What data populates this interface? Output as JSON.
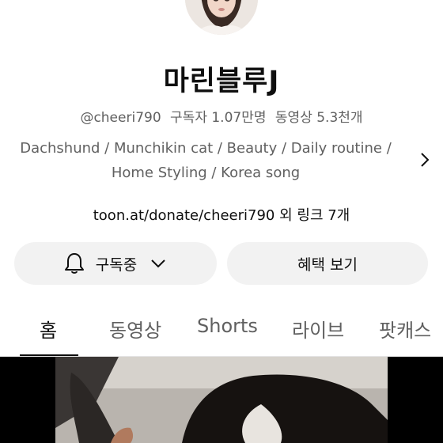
{
  "channel": {
    "name": "마린블루J",
    "handle": "@cheeri790",
    "subscribers": "구독자 1.07만명",
    "videos": "동영상 5.3천개",
    "description_line1": "Dachshund / Munchikin cat / Beauty / Daily routine /",
    "description_line2": "Home Styling / Korea song",
    "link_text": "toon.at/donate/cheeri790 외 링크 7개"
  },
  "actions": {
    "subscribe_label": "구독중",
    "benefits_label": "혜택 보기"
  },
  "tabs": [
    {
      "label": "홈",
      "active": true
    },
    {
      "label": "동영상",
      "active": false
    },
    {
      "label": "Shorts",
      "active": false
    },
    {
      "label": "라이브",
      "active": false
    },
    {
      "label": "팟캐스",
      "active": false
    }
  ],
  "icons": {
    "bell": "bell-icon",
    "chevron_down": "chevron-down-icon",
    "chevron_right": "chevron-right-icon"
  },
  "colors": {
    "text_primary": "#0f0f0f",
    "text_secondary": "#606060",
    "button_bg": "#f2f2f2"
  }
}
